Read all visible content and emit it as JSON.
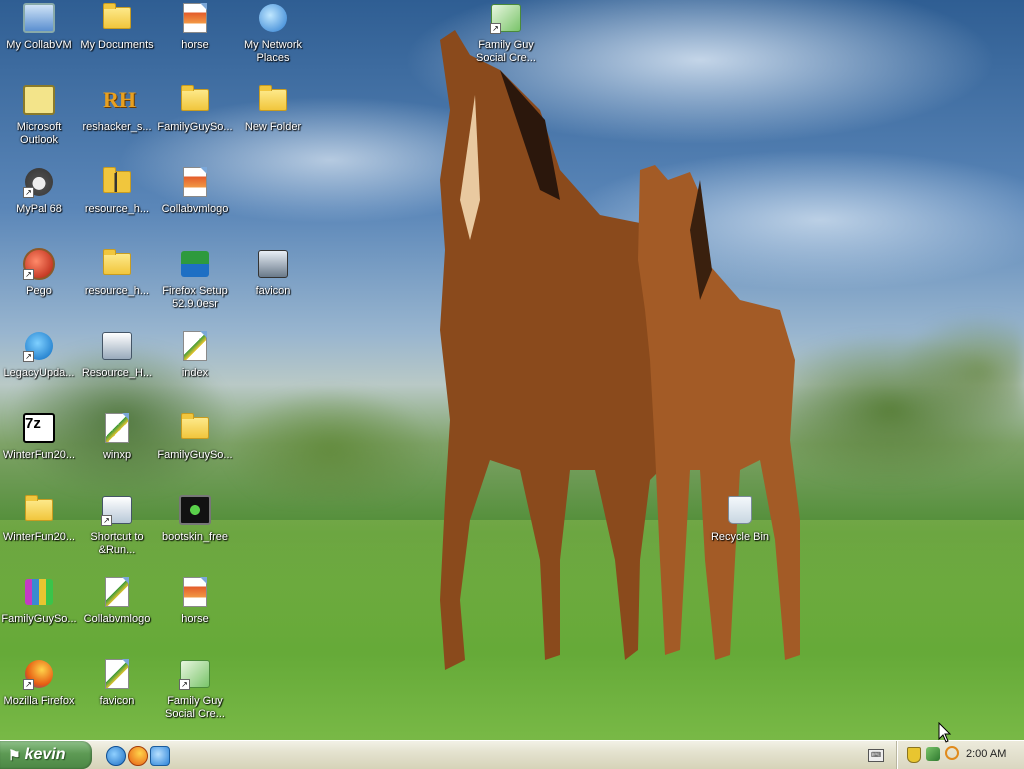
{
  "desktop": {
    "icons": [
      {
        "label": "My CollabVM",
        "icon": "computer-icon"
      },
      {
        "label": "My Documents",
        "icon": "documents-folder-icon"
      },
      {
        "label": "horse",
        "icon": "image-file-icon"
      },
      {
        "label": "My Network Places",
        "icon": "network-icon"
      },
      {
        "label": "Family Guy Social Cre...",
        "icon": "media-player-icon"
      },
      {
        "label": "Microsoft Outlook",
        "icon": "outlook-icon"
      },
      {
        "label": "reshacker_s...",
        "icon": "reshacker-icon"
      },
      {
        "label": "FamilyGuySo...",
        "icon": "folder-icon"
      },
      {
        "label": "New Folder",
        "icon": "folder-icon"
      },
      {
        "label": "MyPal 68",
        "icon": "mypal-icon"
      },
      {
        "label": "resource_h...",
        "icon": "zip-folder-icon"
      },
      {
        "label": "Collabvmlogo",
        "icon": "image-file-icon"
      },
      {
        "label": "Pego",
        "icon": "pego-icon"
      },
      {
        "label": "resource_h...",
        "icon": "folder-icon"
      },
      {
        "label": "Firefox Setup 52.9.0esr",
        "icon": "installer-icon"
      },
      {
        "label": "favicon",
        "icon": "favicon-icon"
      },
      {
        "label": "LegacyUpda...",
        "icon": "legacy-update-icon"
      },
      {
        "label": "Resource_H...",
        "icon": "resource-hacker-icon"
      },
      {
        "label": "index",
        "icon": "html-file-icon"
      },
      {
        "label": "WinterFun20...",
        "icon": "sevenzip-icon"
      },
      {
        "label": "winxp",
        "icon": "html-file-icon"
      },
      {
        "label": "FamilyGuySo...",
        "icon": "folder-icon"
      },
      {
        "label": "WinterFun20...",
        "icon": "folder-icon"
      },
      {
        "label": "Shortcut to &Run...",
        "icon": "run-shortcut-icon"
      },
      {
        "label": "bootskin_free",
        "icon": "bootskin-icon"
      },
      {
        "label": "Recycle Bin",
        "icon": "recycle-bin-icon"
      },
      {
        "label": "FamilyGuySo...",
        "icon": "winrar-icon"
      },
      {
        "label": "Collabvmlogo",
        "icon": "html-file-icon"
      },
      {
        "label": "horse",
        "icon": "image-file-icon"
      },
      {
        "label": "Mozilla Firefox",
        "icon": "firefox-icon"
      },
      {
        "label": "favicon",
        "icon": "html-file-icon"
      },
      {
        "label": "Family Guy Social Cre...",
        "icon": "media-player-icon"
      }
    ]
  },
  "taskbar": {
    "start_label": "kevin",
    "quick_launch": [
      "internet-explorer-icon",
      "firefox-icon",
      "outlook-express-icon"
    ],
    "tray_icons": [
      "keyboard-icon",
      "security-shield-icon",
      "network-icon",
      "search-icon"
    ],
    "clock": "2:00 AM"
  },
  "colors": {
    "start_button": "#5d9a54",
    "taskbar": "#e4e2cf",
    "label_text": "#ffffff"
  }
}
